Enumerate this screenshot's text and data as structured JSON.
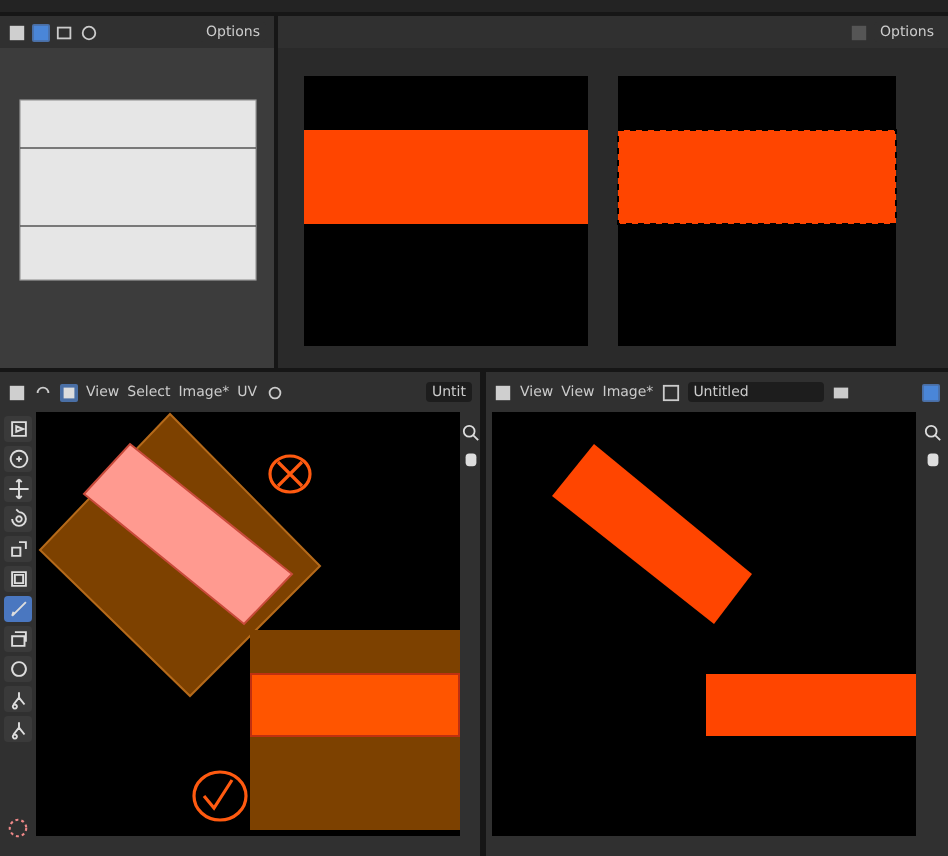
{
  "top_left_editor": {
    "options_menu": "Options"
  },
  "top_right_editor": {
    "options_menu": "Options"
  },
  "uv_editor": {
    "menus": [
      "View",
      "Select",
      "Image*",
      "UV"
    ],
    "image_name": "Untit",
    "tools": [
      {
        "kind": "select",
        "selected": false
      },
      {
        "kind": "cursor",
        "selected": false
      },
      {
        "kind": "move",
        "selected": false
      },
      {
        "kind": "rotate",
        "selected": false
      },
      {
        "kind": "scale",
        "selected": false
      },
      {
        "kind": "transform",
        "selected": false
      },
      {
        "kind": "annotate",
        "selected": true
      },
      {
        "kind": "grab",
        "selected": false
      },
      {
        "kind": "relax",
        "selected": false
      },
      {
        "kind": "pinch",
        "selected": false
      },
      {
        "kind": "pinch",
        "selected": false
      }
    ]
  },
  "image_editor": {
    "menus": [
      "View",
      "View",
      "Image*"
    ],
    "image_name": "Untitled"
  }
}
